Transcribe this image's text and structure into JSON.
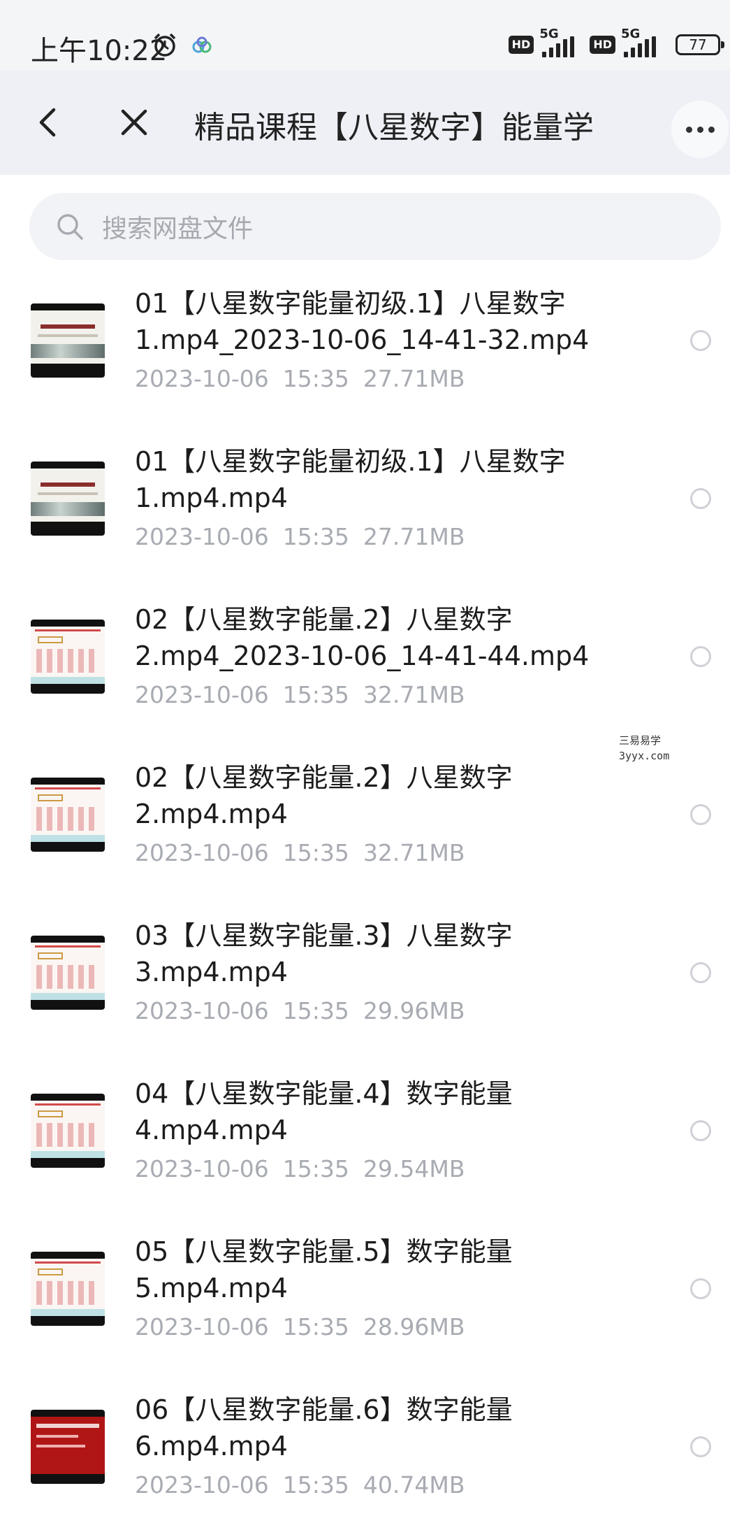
{
  "status_bar": {
    "time": "上午10:22",
    "hd_label": "HD",
    "network_label": "5G",
    "battery": "77"
  },
  "header": {
    "title": "精品课程【八星数字】能量学"
  },
  "search": {
    "placeholder": "搜索网盘文件"
  },
  "files": [
    {
      "line1": "01【八星数字能量初级.1】八星数字",
      "line2": "1.mp4_2023-10-06_14-41-32.mp4",
      "date": "2023-10-06",
      "time": "15:35",
      "size": "27.71MB",
      "thumb": "scroll"
    },
    {
      "line1": "01【八星数字能量初级.1】八星数字",
      "line2": "1.mp4.mp4",
      "date": "2023-10-06",
      "time": "15:35",
      "size": "27.71MB",
      "thumb": "scroll"
    },
    {
      "line1": "02【八星数字能量.2】八星数字",
      "line2": "2.mp4_2023-10-06_14-41-44.mp4",
      "date": "2023-10-06",
      "time": "15:35",
      "size": "32.71MB",
      "thumb": "table"
    },
    {
      "line1": "02【八星数字能量.2】八星数字",
      "line2": "2.mp4.mp4",
      "date": "2023-10-06",
      "time": "15:35",
      "size": "32.71MB",
      "thumb": "table"
    },
    {
      "line1": "03【八星数字能量.3】八星数字",
      "line2": "3.mp4.mp4",
      "date": "2023-10-06",
      "time": "15:35",
      "size": "29.96MB",
      "thumb": "table"
    },
    {
      "line1": "04【八星数字能量.4】数字能量",
      "line2": "4.mp4.mp4",
      "date": "2023-10-06",
      "time": "15:35",
      "size": "29.54MB",
      "thumb": "table"
    },
    {
      "line1": "05【八星数字能量.5】数字能量",
      "line2": "5.mp4.mp4",
      "date": "2023-10-06",
      "time": "15:35",
      "size": "28.96MB",
      "thumb": "table"
    },
    {
      "line1": "06【八星数字能量.6】数字能量",
      "line2": "6.mp4.mp4",
      "date": "2023-10-06",
      "time": "15:35",
      "size": "40.74MB",
      "thumb": "red"
    }
  ],
  "watermark": {
    "line1": "三易易学",
    "line2": "3yyx.com"
  },
  "colors": {
    "header_bg": "#eef0f5",
    "meta_text": "#a8abb2",
    "placeholder_text": "#a6a9b0"
  }
}
